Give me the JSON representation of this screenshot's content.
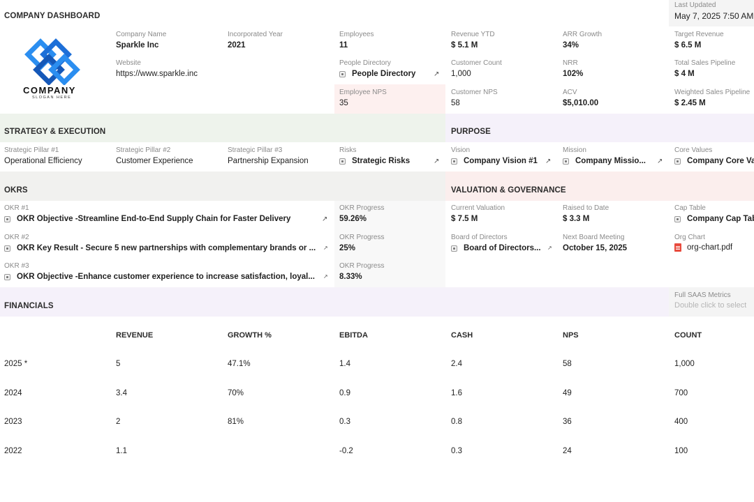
{
  "header": {
    "title": "COMPANY DASHBOARD",
    "last_updated_label": "Last Updated",
    "last_updated_value": "May 7, 2025 7:50 AM"
  },
  "logo": {
    "word": "COMPANY",
    "slogan": "SLOGAN HERE"
  },
  "company": {
    "name_label": "Company Name",
    "name": "Sparkle Inc",
    "website_label": "Website",
    "website": "https://www.sparkle.inc",
    "incorporated_label": "Incorporated Year",
    "incorporated": "2021",
    "employees_label": "Employees",
    "employees": "11",
    "people_dir_label": "People Directory",
    "people_dir": "People Directory",
    "employee_nps_label": "Employee NPS",
    "employee_nps": "35",
    "revenue_ytd_label": "Revenue YTD",
    "revenue_ytd": "$ 5.1 M",
    "customer_count_label": "Customer Count",
    "customer_count": "1,000",
    "customer_nps_label": "Customer NPS",
    "customer_nps": "58",
    "arr_growth_label": "ARR Growth",
    "arr_growth": "34%",
    "nrr_label": "NRR",
    "nrr": "102%",
    "acv_label": "ACV",
    "acv": "$5,010.00",
    "target_revenue_label": "Target Revenue",
    "target_revenue": "$ 6.5 M",
    "total_pipeline_label": "Total Sales Pipeline",
    "total_pipeline": "$ 4 M",
    "weighted_pipeline_label": "Weighted Sales Pipeline",
    "weighted_pipeline": "$ 2.45 M"
  },
  "strategy": {
    "heading": "STRATEGY & EXECUTION",
    "pillar1_label": "Strategic Pillar #1",
    "pillar1": "Operational Efficiency",
    "pillar2_label": "Strategic Pillar #2",
    "pillar2": "Customer Experience",
    "pillar3_label": "Strategic Pillar #3",
    "pillar3": "Partnership Expansion",
    "risks_label": "Risks",
    "risks": "Strategic Risks"
  },
  "purpose": {
    "heading": "PURPOSE",
    "vision_label": "Vision",
    "vision": "Company Vision #1",
    "mission_label": "Mission",
    "mission": "Company Missio...",
    "values_label": "Core Values",
    "values": "Company Core Va"
  },
  "okrs": {
    "heading": "OKRS",
    "okr1_label": "OKR #1",
    "okr1": "OKR Objective -Streamline End-to-End Supply Chain for Faster Delivery",
    "okr2_label": "OKR #2",
    "okr2": "OKR Key Result - Secure 5 new partnerships with complementary brands or ...",
    "okr3_label": "OKR #3",
    "okr3": "OKR Objective -Enhance customer experience to increase satisfaction, loyal...",
    "progress_label": "OKR Progress",
    "progress1": "59.26%",
    "progress2": "25%",
    "progress3": "8.33%"
  },
  "valuation": {
    "heading": "VALUATION & GOVERNANCE",
    "current_label": "Current Valuation",
    "current": "$ 7.5 M",
    "raised_label": "Raised to Date",
    "raised": "$ 3.3 M",
    "cap_label": "Cap Table",
    "cap": "Company Cap Tab",
    "board_label": "Board of Directors",
    "board": "Board of Directors...",
    "meeting_label": "Next Board Meeting",
    "meeting": "October 15, 2025",
    "org_label": "Org Chart",
    "org": "org-chart.pdf"
  },
  "financials": {
    "heading": "FINANCIALS",
    "saas_label": "Full SAAS Metrics",
    "saas_hint": "Double click to select",
    "columns": [
      "REVENUE",
      "GROWTH %",
      "EBITDA",
      "CASH",
      "NPS",
      "COUNT"
    ],
    "rows": [
      {
        "year": "2025 *",
        "revenue": "5",
        "growth": "47.1%",
        "ebitda": "1.4",
        "cash": "2.4",
        "nps": "58",
        "count": "1,000"
      },
      {
        "year": "2024",
        "revenue": "3.4",
        "growth": "70%",
        "ebitda": "0.9",
        "cash": "1.6",
        "nps": "49",
        "count": "700"
      },
      {
        "year": "2023",
        "revenue": "2",
        "growth": "81%",
        "ebitda": "0.3",
        "cash": "0.8",
        "nps": "36",
        "count": "400"
      },
      {
        "year": "2022",
        "revenue": "1.1",
        "growth": "",
        "ebitda": "-0.2",
        "cash": "0.3",
        "nps": "24",
        "count": "100"
      }
    ]
  },
  "colors": {
    "green_section": "#eef3ec",
    "purple_section": "#f5f1fa",
    "red_section": "#fbeeed",
    "gray_section": "#f1f1ef",
    "nps_highlight": "#fdf0ef",
    "logo_blue": "#1d6fd8"
  }
}
